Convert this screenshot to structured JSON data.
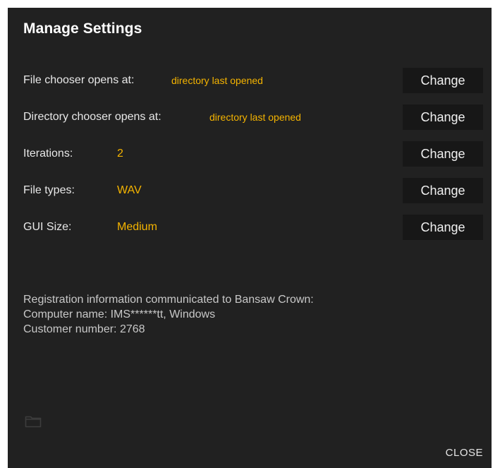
{
  "dialog": {
    "title": "Manage Settings"
  },
  "settings": [
    {
      "label": "File chooser opens at:",
      "value": "directory last opened",
      "button": "Change"
    },
    {
      "label": "Directory chooser opens at:",
      "value": "directory last opened",
      "button": "Change"
    },
    {
      "label": "Iterations:",
      "value": "2",
      "button": "Change"
    },
    {
      "label": "File types:",
      "value": "WAV",
      "button": "Change"
    },
    {
      "label": "GUI Size:",
      "value": "Medium",
      "button": "Change"
    }
  ],
  "registration": {
    "heading": "Registration information communicated to Bansaw Crown:",
    "computer_name": "Computer name: IMS******tt, Windows",
    "customer_number": "Customer number: 2768"
  },
  "icons": {
    "folder": "folder-icon"
  },
  "footer": {
    "close_label": "CLOSE"
  },
  "colors": {
    "background": "#212121",
    "accent": "#f5b400",
    "button": "#171717"
  }
}
